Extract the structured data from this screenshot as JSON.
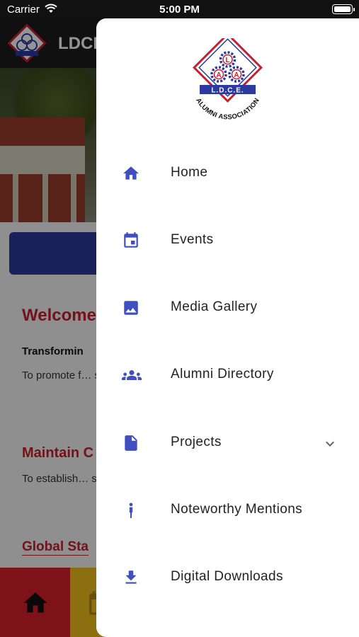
{
  "status_bar": {
    "carrier": "Carrier",
    "time": "5:00 PM"
  },
  "app_bar": {
    "title": "LDCE",
    "logo_text": "L.D.C.E."
  },
  "page": {
    "welcome_heading": "Welcome",
    "transforming_heading": "Transformin",
    "paragraph_1": "To promote f… spread know… College of E… field of Engin…",
    "maintain_heading": "Maintain C",
    "paragraph_2": "To establish… students, pre… LDCE Alumni…",
    "global_heading": "Global Sta"
  },
  "drawer": {
    "logo": {
      "letters": [
        "L",
        "A",
        "A"
      ],
      "banner": "L.D.C.E.",
      "arc_text": "ALUMNI ASSOCIATION"
    },
    "menu": [
      {
        "label": "Home",
        "icon": "home-icon"
      },
      {
        "label": "Events",
        "icon": "calendar-icon"
      },
      {
        "label": "Media Gallery",
        "icon": "image-icon"
      },
      {
        "label": "Alumni Directory",
        "icon": "people-icon"
      },
      {
        "label": "Projects",
        "icon": "document-icon",
        "expandable": true
      },
      {
        "label": "Noteworthy Mentions",
        "icon": "person-icon"
      },
      {
        "label": "Digital Downloads",
        "icon": "download-icon"
      }
    ]
  },
  "colors": {
    "accent": "#3f4ec0",
    "brand_red": "#c4202f",
    "nav_red": "#d8202a",
    "nav_yellow": "#f1c21b",
    "drawer_bg": "#ffffff"
  }
}
